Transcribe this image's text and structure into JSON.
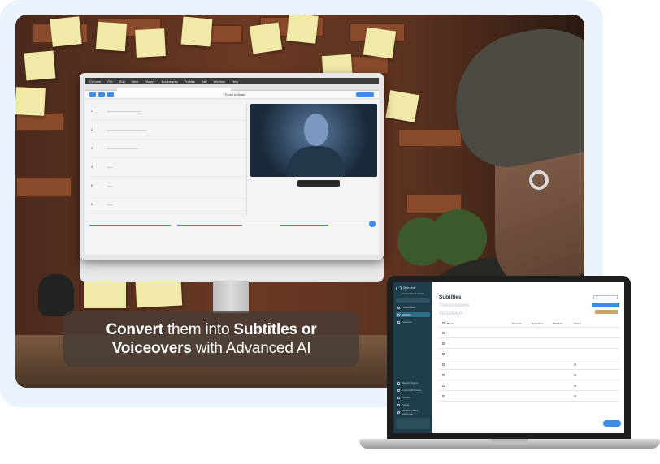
{
  "caption": {
    "line1_bold_a": "Convert",
    "line1_text": " them into ",
    "line1_bold_b": "Subtitles or",
    "line2_bold": "Voiceovers",
    "line2_text": " with Advanced AI"
  },
  "monitor_app": {
    "menu_items": [
      "Chrome",
      "File",
      "Edit",
      "View",
      "History",
      "Bookmarks",
      "Profiles",
      "Tab",
      "Window",
      "Help"
    ],
    "title": "Touch to Bake",
    "segments": [
      "1",
      "2",
      "3",
      "4",
      "5",
      "6"
    ]
  },
  "laptop_app": {
    "logo": "Maestra",
    "workspace": "WORKSPACE NAME",
    "sidebar_items": [
      "Transcription",
      "Subtitles",
      "Voiceover"
    ],
    "sidebar_bottom": [
      "Maestra Teams",
      "Custom Dictionary",
      "Account",
      "Pricing",
      "Maestra Teams Enterprise"
    ],
    "types": [
      "Subtitles",
      "Transcriptions",
      "Voiceovers"
    ],
    "active_type": "Subtitles",
    "columns": [
      "Name",
      "Duration",
      "Uploaded",
      "Modified",
      "Status"
    ],
    "rows": [
      {
        "name": "",
        "duration": "",
        "uploaded": "",
        "modified": "",
        "status": ""
      },
      {
        "name": "",
        "duration": "",
        "uploaded": "",
        "modified": "",
        "status": ""
      },
      {
        "name": "",
        "duration": "",
        "uploaded": "",
        "modified": "",
        "status": ""
      },
      {
        "name": "",
        "duration": "",
        "uploaded": "",
        "modified": "",
        "status": ""
      },
      {
        "name": "",
        "duration": "",
        "uploaded": "",
        "modified": "",
        "status": ""
      },
      {
        "name": "",
        "duration": "",
        "uploaded": "",
        "modified": "",
        "status": ""
      },
      {
        "name": "",
        "duration": "",
        "uploaded": "",
        "modified": "",
        "status": ""
      }
    ]
  }
}
